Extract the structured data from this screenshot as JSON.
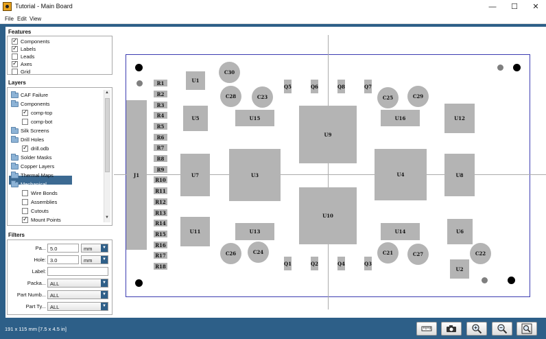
{
  "window": {
    "title": "Tutorial - Main Board",
    "minimize": "—",
    "maximize": "☐",
    "close": "✕"
  },
  "menu": [
    "File",
    "Edit",
    "View"
  ],
  "features": {
    "title": "Features",
    "items": [
      {
        "label": "Components",
        "checked": true
      },
      {
        "label": "Labels",
        "checked": true
      },
      {
        "label": "Leads",
        "checked": false
      },
      {
        "label": "Axes",
        "checked": true
      },
      {
        "label": "Grid",
        "checked": false
      }
    ]
  },
  "layers": {
    "title": "Layers",
    "items": [
      {
        "label": "CAF Failure",
        "type": "folder"
      },
      {
        "label": "Components",
        "type": "folder"
      },
      {
        "label": "comp-top",
        "type": "check",
        "checked": true
      },
      {
        "label": "comp-bot",
        "type": "check",
        "checked": false
      },
      {
        "label": "Silk Screens",
        "type": "folder"
      },
      {
        "label": "Drill Holes",
        "type": "folder"
      },
      {
        "label": "drill.odb",
        "type": "check",
        "checked": true
      },
      {
        "label": "Solder Masks",
        "type": "folder"
      },
      {
        "label": "Copper Layers",
        "type": "folder"
      },
      {
        "label": "Thermal Maps",
        "type": "folder"
      },
      {
        "label": "Mechanical",
        "type": "folder",
        "selected": true
      },
      {
        "label": "Wire Bonds",
        "type": "check",
        "checked": false
      },
      {
        "label": "Assemblies",
        "type": "check",
        "checked": false
      },
      {
        "label": "Cutouts",
        "type": "check",
        "checked": false
      },
      {
        "label": "Mount Points",
        "type": "check",
        "checked": true
      }
    ]
  },
  "filters": {
    "title": "Filters",
    "pad": {
      "label": "Pa...",
      "value": "5.0",
      "unit": "mm"
    },
    "hole": {
      "label": "Hole:",
      "value": "3.0",
      "unit": "mm"
    },
    "label_field": {
      "label": "Label:",
      "value": ""
    },
    "package": {
      "label": "Packa...",
      "value": "ALL"
    },
    "part_number": {
      "label": "Part Numb...",
      "value": "ALL"
    },
    "part_type": {
      "label": "Part Ty...",
      "value": "ALL"
    }
  },
  "board": {
    "resistors": [
      "R1",
      "R2",
      "R3",
      "R4",
      "R5",
      "R6",
      "R7",
      "R8",
      "R9",
      "R10",
      "R11",
      "R12",
      "R13",
      "R14",
      "R15",
      "R16",
      "R17",
      "R18"
    ],
    "connector": "J1",
    "u1": "U1",
    "u2": "U2",
    "u3": "U3",
    "u4": "U4",
    "u5": "U5",
    "u6": "U6",
    "u7": "U7",
    "u8": "U8",
    "u9": "U9",
    "u10": "U10",
    "u11": "U11",
    "u12": "U12",
    "u13": "U13",
    "u14": "U14",
    "u15": "U15",
    "u16": "U16",
    "q1": "Q1",
    "q2": "Q2",
    "q3": "Q3",
    "q4": "Q4",
    "q5": "Q5",
    "q6": "Q6",
    "q7": "Q7",
    "q8": "Q8",
    "c21": "C21",
    "c22": "C22",
    "c23": "C23",
    "c24": "C24",
    "c25": "C25",
    "c26": "C26",
    "c27": "C27",
    "c28": "C28",
    "c29": "C29",
    "c30": "C30"
  },
  "status": {
    "dimensions": "191 x 115 mm  [7.5 x 4.5 in]"
  },
  "toolbar": [
    "ruler-icon",
    "camera-icon",
    "zoom-in-icon",
    "zoom-out-icon",
    "zoom-fit-icon"
  ],
  "colors": {
    "accent": "#2d5f88",
    "component": "#b4b4b4",
    "board_outline": "#3b3bb0"
  }
}
